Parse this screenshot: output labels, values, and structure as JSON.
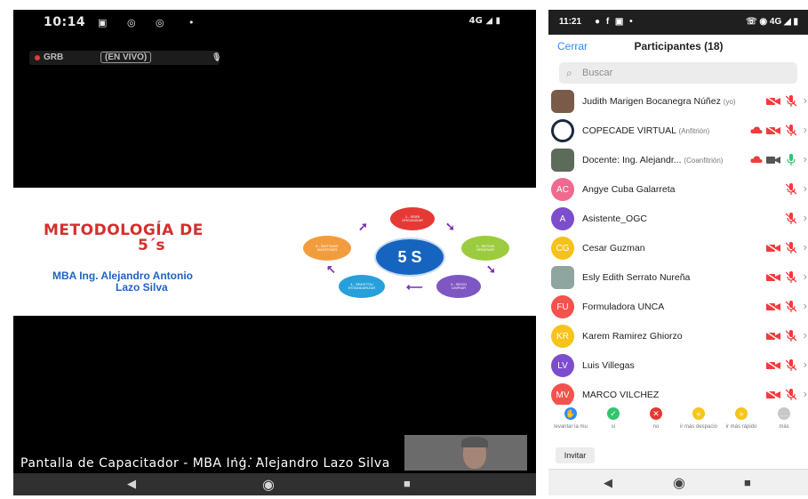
{
  "left_phone": {
    "status": {
      "time": "10:14",
      "network": "4G"
    },
    "recording": {
      "label": "GRB",
      "live_badge": "(EN VIVO)"
    },
    "slide": {
      "title_line1": "METODOLOGÍA DE",
      "title_line2": "5´s",
      "author_line1": "MBA Ing. Alejandro Antonio",
      "author_line2": "Lazo Silva",
      "center": "5 S",
      "nodes": [
        {
          "label": "1.- SEIRI\nORGANIZAR",
          "color": "#e53935"
        },
        {
          "label": "2.- SEITON\nORDENAR",
          "color": "#9ccc3d"
        },
        {
          "label": "3.- SEISO\nLIMPIAR",
          "color": "#7e57c2"
        },
        {
          "label": "4.- SEIKETSU\nESTANDARIZAR",
          "color": "#26a0da"
        },
        {
          "label": "5.- SHITSUKE\nMANTENER",
          "color": "#f39c3d"
        }
      ]
    },
    "caption": "Pantalla de Capacitador - MBA Ing. Alejandro Lazo Silva"
  },
  "right_phone": {
    "status": {
      "time": "11:21",
      "network": "4G"
    },
    "header": {
      "close": "Cerrar",
      "title": "Participantes (18)"
    },
    "search_placeholder": "Buscar",
    "participants": [
      {
        "name": "Judith Marigen Bocanegra Núñez",
        "role": "(yo)",
        "initials": "",
        "avatar": "photo-woman",
        "color": "#7a5a48",
        "cloud": false,
        "video": "off",
        "mic": "off"
      },
      {
        "name": "COPECADE VIRTUAL",
        "role": "(Anfitrión)",
        "initials": "",
        "avatar": "logo-copecade",
        "color": "#1b2a3a",
        "cloud": true,
        "video": "off",
        "mic": "off"
      },
      {
        "name": "Docente: Ing. Alejandr...",
        "role": "(Coanfitrión)",
        "initials": "",
        "avatar": "photo-man",
        "color": "#5c6b5a",
        "cloud": true,
        "video": "on",
        "mic": "on"
      },
      {
        "name": "Angye Cuba Galarreta",
        "role": "",
        "initials": "AC",
        "avatar": "initials",
        "color": "#ef6a8f",
        "cloud": false,
        "video": "none",
        "mic": "off"
      },
      {
        "name": "Asistente_OGC",
        "role": "",
        "initials": "A",
        "avatar": "initials",
        "color": "#7c4dcc",
        "cloud": false,
        "video": "none",
        "mic": "off"
      },
      {
        "name": "Cesar Guzman",
        "role": "",
        "initials": "CG",
        "avatar": "initials",
        "color": "#f4c21a",
        "cloud": false,
        "video": "off",
        "mic": "off"
      },
      {
        "name": "Esly Edith Serrato Nureña",
        "role": "",
        "initials": "",
        "avatar": "photo-group",
        "color": "#8fa6a0",
        "cloud": false,
        "video": "off",
        "mic": "off"
      },
      {
        "name": "Formuladora UNCA",
        "role": "",
        "initials": "FU",
        "avatar": "initials",
        "color": "#f4524d",
        "cloud": false,
        "video": "off",
        "mic": "off"
      },
      {
        "name": "Karem Ramirez Ghiorzo",
        "role": "",
        "initials": "KR",
        "avatar": "initials",
        "color": "#f7c21b",
        "cloud": false,
        "video": "off",
        "mic": "off"
      },
      {
        "name": "Luis Villegas",
        "role": "",
        "initials": "LV",
        "avatar": "initials",
        "color": "#7c4dcc",
        "cloud": false,
        "video": "off",
        "mic": "off"
      },
      {
        "name": "MARCO VILCHEZ",
        "role": "",
        "initials": "MV",
        "avatar": "initials",
        "color": "#f4524d",
        "cloud": false,
        "video": "off",
        "mic": "off"
      }
    ],
    "reactions": [
      {
        "label": "levantar la mu",
        "icon": "raise-hand-icon",
        "color": "#2d8cff",
        "glyph": "✋"
      },
      {
        "label": "sí",
        "icon": "check-icon",
        "color": "#33c46e",
        "glyph": "✓"
      },
      {
        "label": "no",
        "icon": "x-icon",
        "color": "#e53935",
        "glyph": "✕"
      },
      {
        "label": "ir más despacio",
        "icon": "slower-icon",
        "color": "#f5c518",
        "glyph": "«"
      },
      {
        "label": "ir más rápido",
        "icon": "faster-icon",
        "color": "#f5c518",
        "glyph": "»"
      },
      {
        "label": "más",
        "icon": "more-icon",
        "color": "#c7c7cc",
        "glyph": "…"
      }
    ],
    "invite": "Invitar"
  }
}
